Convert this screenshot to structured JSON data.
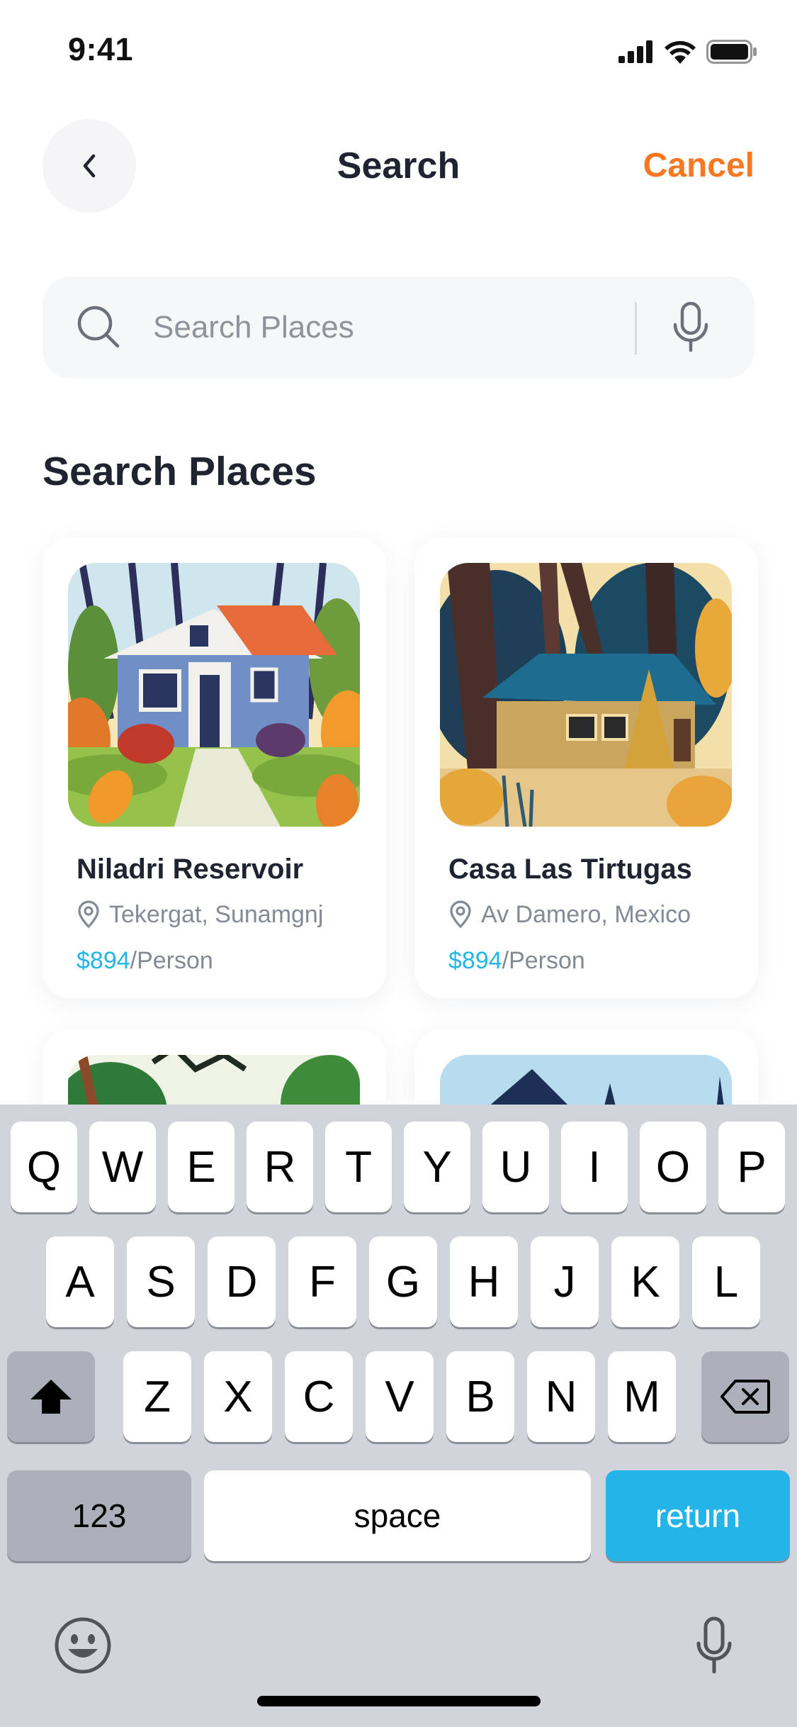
{
  "status": {
    "time": "9:41"
  },
  "header": {
    "title": "Search",
    "cancel": "Cancel"
  },
  "search": {
    "placeholder": "Search Places",
    "value": ""
  },
  "section": {
    "title": "Search Places"
  },
  "places": [
    {
      "name": "Niladri Reservoir",
      "location": "Tekergat, Sunamgnj",
      "price": "$894",
      "unit": "/Person"
    },
    {
      "name": "Casa Las Tirtugas",
      "location": "Av Damero, Mexico",
      "price": "$894",
      "unit": "/Person"
    }
  ],
  "keyboard": {
    "row1": [
      "Q",
      "W",
      "E",
      "R",
      "T",
      "Y",
      "U",
      "I",
      "O",
      "P"
    ],
    "row2": [
      "A",
      "S",
      "D",
      "F",
      "G",
      "H",
      "J",
      "K",
      "L"
    ],
    "row3": [
      "Z",
      "X",
      "C",
      "V",
      "B",
      "N",
      "M"
    ],
    "numbers": "123",
    "space": "space",
    "return": "return"
  },
  "colors": {
    "accent": "#f77821",
    "price": "#22b5e6",
    "return_key": "#24b4e8"
  }
}
